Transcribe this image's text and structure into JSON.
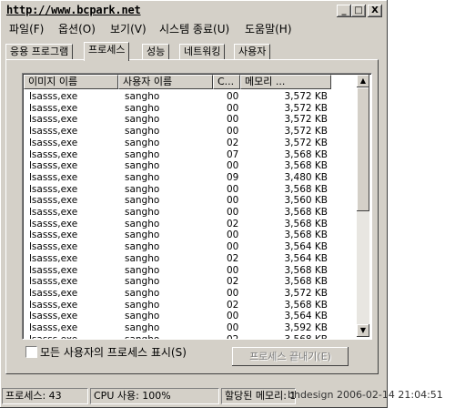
{
  "window": {
    "title": "http://www.bcpark.net",
    "controls": {
      "minimize": "_",
      "maximize": "□",
      "close": "X"
    }
  },
  "menu": [
    "파일(F)",
    "옵션(O)",
    "보기(V)",
    "시스템 종료(U)",
    "도움말(H)"
  ],
  "tabs": [
    "응용 프로그램",
    "프로세스",
    "성능",
    "네트워킹",
    "사용자"
  ],
  "active_tab": "프로세스",
  "columns": [
    "이미지 이름",
    "사용자 이름",
    "C...",
    "메모리 ..."
  ],
  "rows": [
    {
      "image": "lsasss,exe",
      "user": "sangho",
      "cpu": "00",
      "mem": "3,572 KB"
    },
    {
      "image": "lsasss,exe",
      "user": "sangho",
      "cpu": "00",
      "mem": "3,572 KB"
    },
    {
      "image": "lsasss,exe",
      "user": "sangho",
      "cpu": "00",
      "mem": "3,572 KB"
    },
    {
      "image": "lsasss,exe",
      "user": "sangho",
      "cpu": "00",
      "mem": "3,572 KB"
    },
    {
      "image": "lsasss,exe",
      "user": "sangho",
      "cpu": "02",
      "mem": "3,572 KB"
    },
    {
      "image": "lsasss,exe",
      "user": "sangho",
      "cpu": "07",
      "mem": "3,568 KB"
    },
    {
      "image": "lsasss,exe",
      "user": "sangho",
      "cpu": "00",
      "mem": "3,568 KB"
    },
    {
      "image": "lsasss,exe",
      "user": "sangho",
      "cpu": "09",
      "mem": "3,480 KB"
    },
    {
      "image": "lsasss,exe",
      "user": "sangho",
      "cpu": "00",
      "mem": "3,568 KB"
    },
    {
      "image": "lsasss,exe",
      "user": "sangho",
      "cpu": "00",
      "mem": "3,560 KB"
    },
    {
      "image": "lsasss,exe",
      "user": "sangho",
      "cpu": "00",
      "mem": "3,568 KB"
    },
    {
      "image": "lsasss,exe",
      "user": "sangho",
      "cpu": "02",
      "mem": "3,568 KB"
    },
    {
      "image": "lsasss,exe",
      "user": "sangho",
      "cpu": "00",
      "mem": "3,568 KB"
    },
    {
      "image": "lsasss,exe",
      "user": "sangho",
      "cpu": "00",
      "mem": "3,564 KB"
    },
    {
      "image": "lsasss,exe",
      "user": "sangho",
      "cpu": "02",
      "mem": "3,564 KB"
    },
    {
      "image": "lsasss,exe",
      "user": "sangho",
      "cpu": "00",
      "mem": "3,568 KB"
    },
    {
      "image": "lsasss,exe",
      "user": "sangho",
      "cpu": "02",
      "mem": "3,568 KB"
    },
    {
      "image": "lsasss,exe",
      "user": "sangho",
      "cpu": "00",
      "mem": "3,572 KB"
    },
    {
      "image": "lsasss,exe",
      "user": "sangho",
      "cpu": "02",
      "mem": "3,568 KB"
    },
    {
      "image": "lsasss,exe",
      "user": "sangho",
      "cpu": "00",
      "mem": "3,564 KB"
    },
    {
      "image": "lsasss,exe",
      "user": "sangho",
      "cpu": "00",
      "mem": "3,592 KB"
    },
    {
      "image": "lsasss,exe",
      "user": "sangho",
      "cpu": "02",
      "mem": "3,568 KB"
    }
  ],
  "show_all_label": "모든 사용자의 프로세스 표시(S)",
  "show_all_checked": false,
  "end_process_label": "프로세스 끝내기(E)",
  "status": {
    "processes": "프로세스: 43",
    "cpu": "CPU 사용: 100%",
    "memory": "할당된 메모리: 164M",
    "watermark": "bhdesign 2006-02-14 21:04:51"
  }
}
